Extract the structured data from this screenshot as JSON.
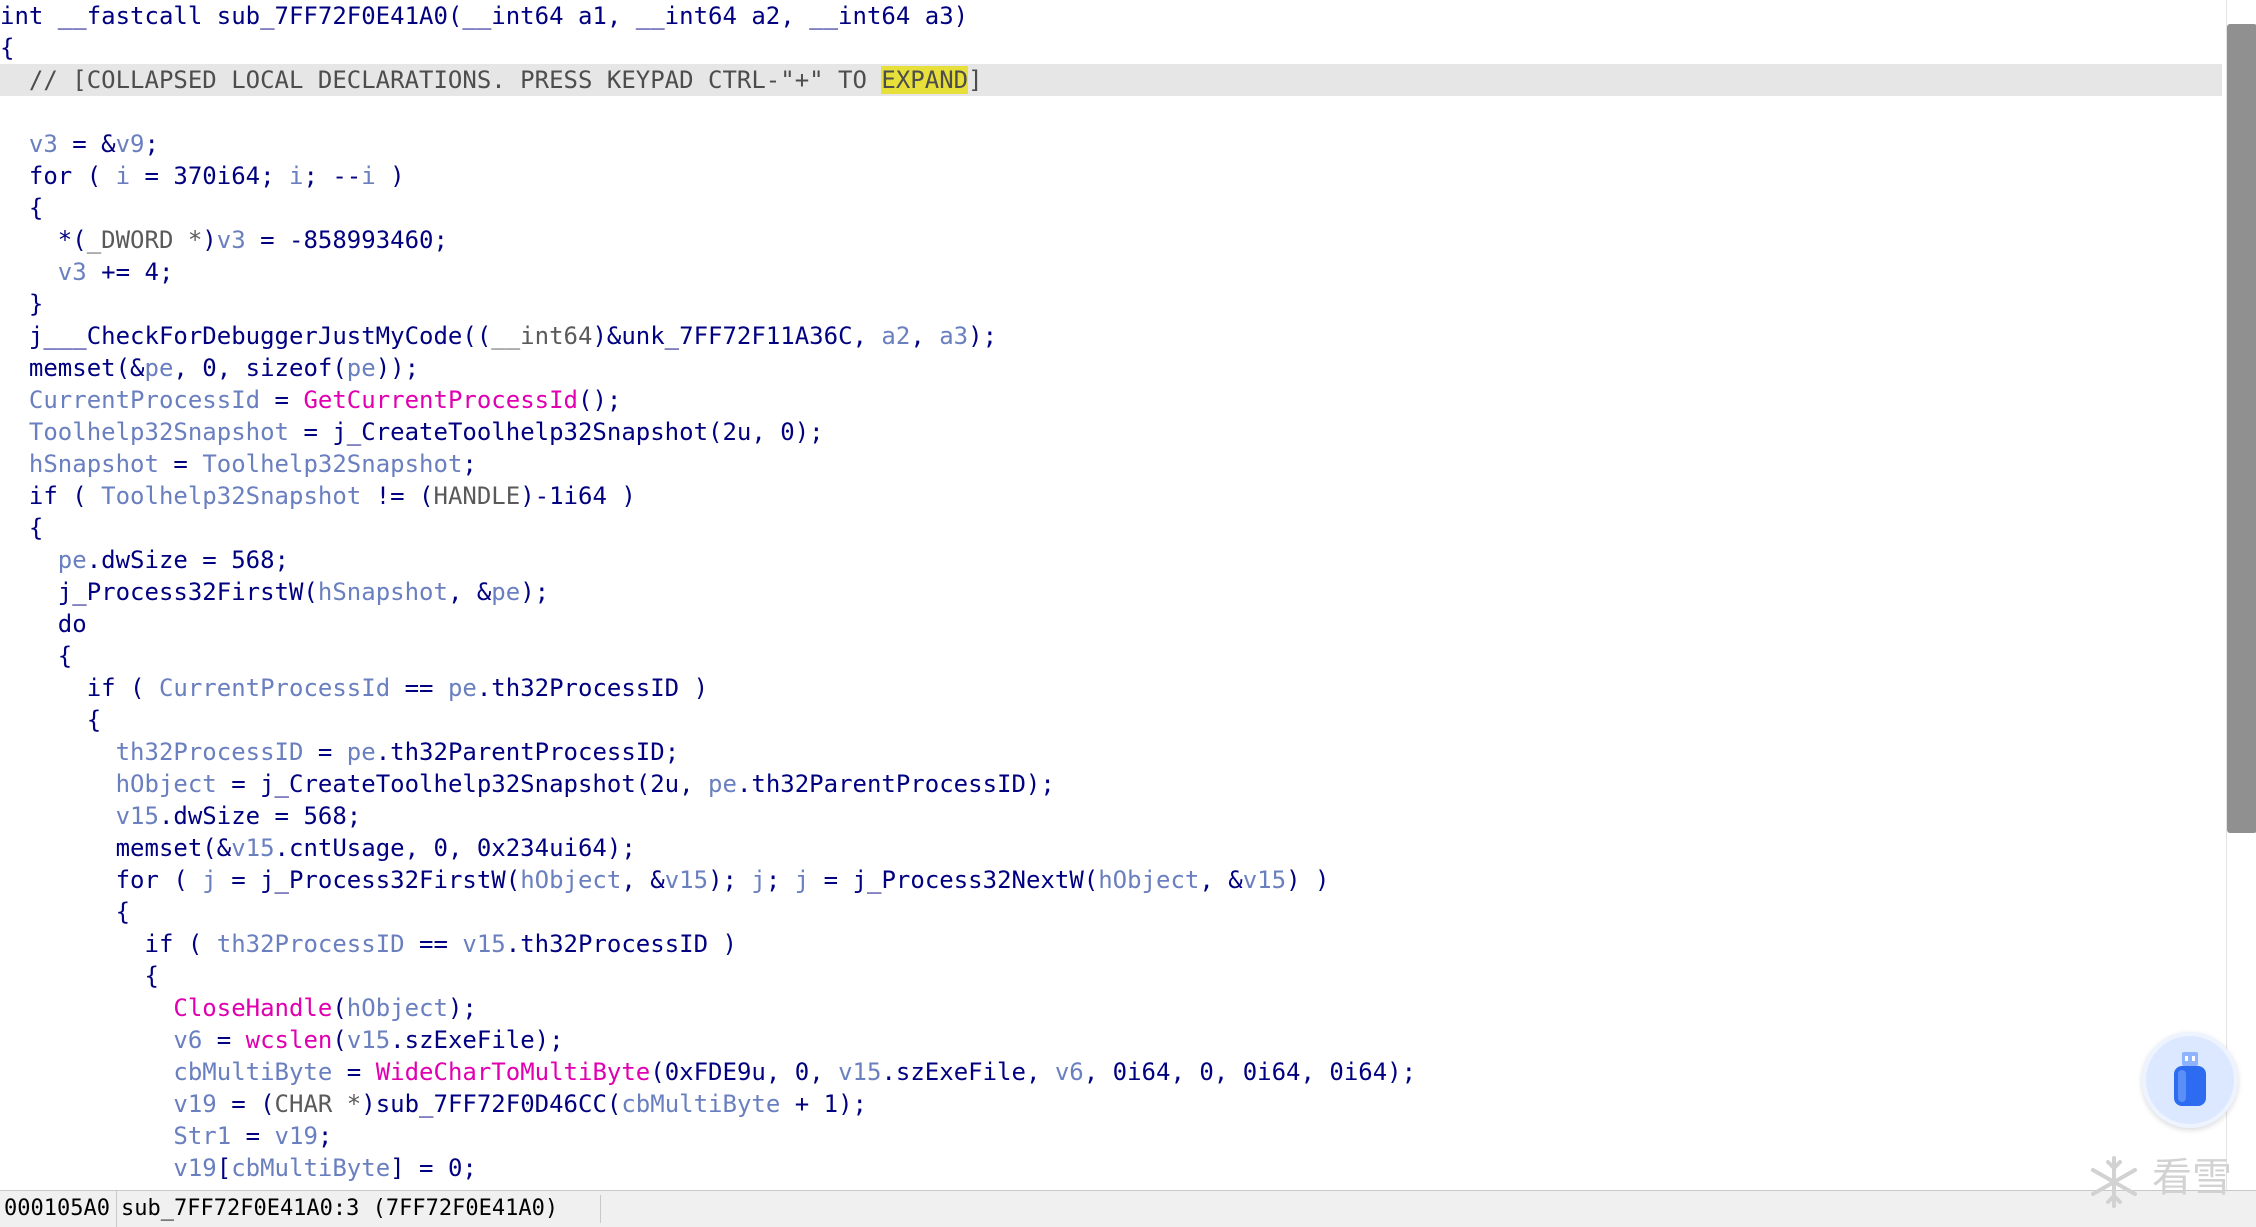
{
  "colors": {
    "keyword": "#000080",
    "variable": "#6a7fbf",
    "api_call": "#e000b0",
    "type": "#5a5a5a",
    "comment": "#4d4d4d",
    "search_highlight": "#e8e03a",
    "current_line": "#e6e6e6"
  },
  "code_lines": [
    [
      [
        "kw",
        "int __fastcall sub_7FF72F0E41A0(__int64 a1, __int64 a2, __int64 a3)"
      ]
    ],
    [
      [
        "kw",
        "{"
      ]
    ],
    [
      [
        "comment",
        "  // [COLLAPSED LOCAL DECLARATIONS. PRESS KEYPAD CTRL-\"+\" TO "
      ],
      [
        "mark",
        "EXPAND"
      ],
      [
        "comment",
        "]"
      ]
    ],
    [],
    [
      [
        "kw",
        "  "
      ],
      [
        "var",
        "v3"
      ],
      [
        "kw",
        " = &"
      ],
      [
        "var",
        "v9"
      ],
      [
        "kw",
        ";"
      ]
    ],
    [
      [
        "kw",
        "  for ( "
      ],
      [
        "var",
        "i"
      ],
      [
        "kw",
        " = 370i64; "
      ],
      [
        "var",
        "i"
      ],
      [
        "kw",
        "; --"
      ],
      [
        "var",
        "i"
      ],
      [
        "kw",
        " )"
      ]
    ],
    [
      [
        "kw",
        "  {"
      ]
    ],
    [
      [
        "kw",
        "    *("
      ],
      [
        "type",
        "_DWORD *"
      ],
      [
        "kw",
        ")"
      ],
      [
        "var",
        "v3"
      ],
      [
        "kw",
        " = -858993460;"
      ]
    ],
    [
      [
        "kw",
        "    "
      ],
      [
        "var",
        "v3"
      ],
      [
        "kw",
        " += 4;"
      ]
    ],
    [
      [
        "kw",
        "  }"
      ]
    ],
    [
      [
        "kw",
        "  j___CheckForDebuggerJustMyCode(("
      ],
      [
        "type",
        "__int64"
      ],
      [
        "kw",
        ")&unk_7FF72F11A36C, "
      ],
      [
        "var",
        "a2"
      ],
      [
        "kw",
        ", "
      ],
      [
        "var",
        "a3"
      ],
      [
        "kw",
        ");"
      ]
    ],
    [
      [
        "kw",
        "  memset(&"
      ],
      [
        "var",
        "pe"
      ],
      [
        "kw",
        ", 0, sizeof("
      ],
      [
        "var",
        "pe"
      ],
      [
        "kw",
        "));"
      ]
    ],
    [
      [
        "kw",
        "  "
      ],
      [
        "var",
        "CurrentProcessId"
      ],
      [
        "kw",
        " = "
      ],
      [
        "api",
        "GetCurrentProcessId"
      ],
      [
        "kw",
        "();"
      ]
    ],
    [
      [
        "kw",
        "  "
      ],
      [
        "var",
        "Toolhelp32Snapshot"
      ],
      [
        "kw",
        " = j_CreateToolhelp32Snapshot(2u, 0);"
      ]
    ],
    [
      [
        "kw",
        "  "
      ],
      [
        "var",
        "hSnapshot"
      ],
      [
        "kw",
        " = "
      ],
      [
        "var",
        "Toolhelp32Snapshot"
      ],
      [
        "kw",
        ";"
      ]
    ],
    [
      [
        "kw",
        "  if ( "
      ],
      [
        "var",
        "Toolhelp32Snapshot"
      ],
      [
        "kw",
        " != ("
      ],
      [
        "type",
        "HANDLE"
      ],
      [
        "kw",
        ")-1i64 )"
      ]
    ],
    [
      [
        "kw",
        "  {"
      ]
    ],
    [
      [
        "kw",
        "    "
      ],
      [
        "var",
        "pe"
      ],
      [
        "kw",
        ".dwSize = 568;"
      ]
    ],
    [
      [
        "kw",
        "    j_Process32FirstW("
      ],
      [
        "var",
        "hSnapshot"
      ],
      [
        "kw",
        ", &"
      ],
      [
        "var",
        "pe"
      ],
      [
        "kw",
        ");"
      ]
    ],
    [
      [
        "kw",
        "    do"
      ]
    ],
    [
      [
        "kw",
        "    {"
      ]
    ],
    [
      [
        "kw",
        "      if ( "
      ],
      [
        "var",
        "CurrentProcessId"
      ],
      [
        "kw",
        " == "
      ],
      [
        "var",
        "pe"
      ],
      [
        "kw",
        ".th32ProcessID )"
      ]
    ],
    [
      [
        "kw",
        "      {"
      ]
    ],
    [
      [
        "kw",
        "        "
      ],
      [
        "var",
        "th32ProcessID"
      ],
      [
        "kw",
        " = "
      ],
      [
        "var",
        "pe"
      ],
      [
        "kw",
        ".th32ParentProcessID;"
      ]
    ],
    [
      [
        "kw",
        "        "
      ],
      [
        "var",
        "hObject"
      ],
      [
        "kw",
        " = j_CreateToolhelp32Snapshot(2u, "
      ],
      [
        "var",
        "pe"
      ],
      [
        "kw",
        ".th32ParentProcessID);"
      ]
    ],
    [
      [
        "kw",
        "        "
      ],
      [
        "var",
        "v15"
      ],
      [
        "kw",
        ".dwSize = 568;"
      ]
    ],
    [
      [
        "kw",
        "        memset(&"
      ],
      [
        "var",
        "v15"
      ],
      [
        "kw",
        ".cntUsage, 0, 0x234ui64);"
      ]
    ],
    [
      [
        "kw",
        "        for ( "
      ],
      [
        "var",
        "j"
      ],
      [
        "kw",
        " = j_Process32FirstW("
      ],
      [
        "var",
        "hObject"
      ],
      [
        "kw",
        ", &"
      ],
      [
        "var",
        "v15"
      ],
      [
        "kw",
        "); "
      ],
      [
        "var",
        "j"
      ],
      [
        "kw",
        "; "
      ],
      [
        "var",
        "j"
      ],
      [
        "kw",
        " = j_Process32NextW("
      ],
      [
        "var",
        "hObject"
      ],
      [
        "kw",
        ", &"
      ],
      [
        "var",
        "v15"
      ],
      [
        "kw",
        ") )"
      ]
    ],
    [
      [
        "kw",
        "        {"
      ]
    ],
    [
      [
        "kw",
        "          if ( "
      ],
      [
        "var",
        "th32ProcessID"
      ],
      [
        "kw",
        " == "
      ],
      [
        "var",
        "v15"
      ],
      [
        "kw",
        ".th32ProcessID )"
      ]
    ],
    [
      [
        "kw",
        "          {"
      ]
    ],
    [
      [
        "kw",
        "            "
      ],
      [
        "api",
        "CloseHandle"
      ],
      [
        "kw",
        "("
      ],
      [
        "var",
        "hObject"
      ],
      [
        "kw",
        ");"
      ]
    ],
    [
      [
        "kw",
        "            "
      ],
      [
        "var",
        "v6"
      ],
      [
        "kw",
        " = "
      ],
      [
        "api",
        "wcslen"
      ],
      [
        "kw",
        "("
      ],
      [
        "var",
        "v15"
      ],
      [
        "kw",
        ".szExeFile);"
      ]
    ],
    [
      [
        "kw",
        "            "
      ],
      [
        "var",
        "cbMultiByte"
      ],
      [
        "kw",
        " = "
      ],
      [
        "api",
        "WideCharToMultiByte"
      ],
      [
        "kw",
        "(0xFDE9u, 0, "
      ],
      [
        "var",
        "v15"
      ],
      [
        "kw",
        ".szExeFile, "
      ],
      [
        "var",
        "v6"
      ],
      [
        "kw",
        ", 0i64, 0, 0i64, 0i64);"
      ]
    ],
    [
      [
        "kw",
        "            "
      ],
      [
        "var",
        "v19"
      ],
      [
        "kw",
        " = ("
      ],
      [
        "type",
        "CHAR *"
      ],
      [
        "kw",
        ")sub_7FF72F0D46CC("
      ],
      [
        "var",
        "cbMultiByte"
      ],
      [
        "kw",
        " + 1);"
      ]
    ],
    [
      [
        "kw",
        "            "
      ],
      [
        "var",
        "Str1"
      ],
      [
        "kw",
        " = "
      ],
      [
        "var",
        "v19"
      ],
      [
        "kw",
        ";"
      ]
    ],
    [
      [
        "kw",
        "            "
      ],
      [
        "var",
        "v19"
      ],
      [
        "kw",
        "["
      ],
      [
        "var",
        "cbMultiByte"
      ],
      [
        "kw",
        "] = 0;"
      ]
    ]
  ],
  "current_line_index": 2,
  "scrollbar": {
    "thumb_start": 0.02,
    "thumb_end": 0.7
  },
  "status": {
    "address": "000105A0",
    "location": "sub_7FF72F0E41A0:3 (7FF72F0E41A0)"
  },
  "float_button": {
    "icon": "usb-drive-icon"
  },
  "watermark": {
    "icon": "snowflake-icon",
    "text": "看雪"
  }
}
